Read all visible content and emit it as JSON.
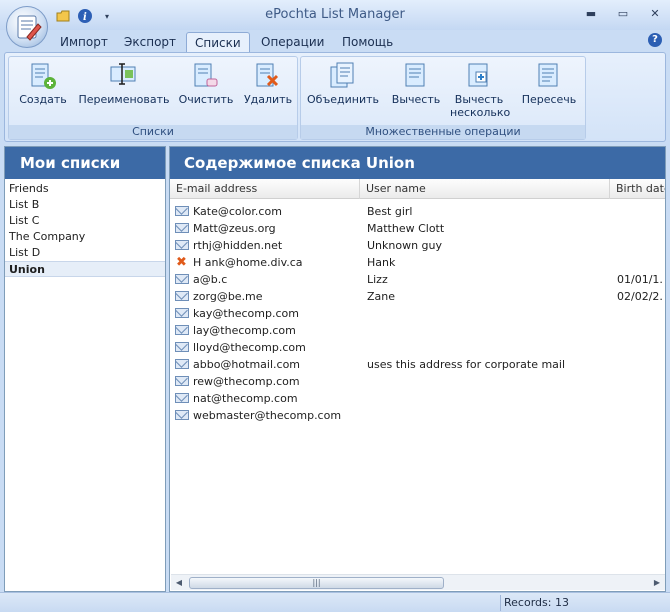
{
  "window": {
    "title": "ePochta List Manager"
  },
  "tabs": [
    {
      "label": "Импорт"
    },
    {
      "label": "Экспорт"
    },
    {
      "label": "Списки",
      "active": true
    },
    {
      "label": "Операции"
    },
    {
      "label": "Помощь"
    }
  ],
  "ribbon": {
    "lists_group": {
      "label": "Списки",
      "buttons": [
        {
          "label": "Создать",
          "icon": "create-list-icon"
        },
        {
          "label": "Переименовать",
          "icon": "rename-list-icon"
        },
        {
          "label": "Очистить",
          "icon": "clear-list-icon"
        },
        {
          "label": "Удалить",
          "icon": "delete-list-icon"
        }
      ]
    },
    "set_ops_group": {
      "label": "Множественные операции",
      "buttons": [
        {
          "label": "Объединить",
          "icon": "merge-lists-icon"
        },
        {
          "label": "Вычесть",
          "icon": "subtract-list-icon"
        },
        {
          "label": "Вычесть несколько",
          "icon": "subtract-multiple-icon"
        },
        {
          "label": "Пересечь",
          "icon": "intersect-lists-icon"
        }
      ]
    }
  },
  "left_pane": {
    "title": "Мои списки",
    "lists": [
      "Friends",
      "List B",
      "List C",
      "The Company",
      "List D",
      "Union"
    ],
    "selected": "Union"
  },
  "right_pane": {
    "title": "Содержимое списка Union",
    "columns": [
      "E-mail address",
      "User name",
      "Birth date"
    ],
    "rows": [
      {
        "email": "Kate@color.com",
        "name": "Best girl",
        "birth": "",
        "status": "ok"
      },
      {
        "email": "Matt@zeus.org",
        "name": "Matthew Clott",
        "birth": "",
        "status": "ok"
      },
      {
        "email": "rthj@hidden.net",
        "name": "Unknown guy",
        "birth": "",
        "status": "ok"
      },
      {
        "email": "H ank@home.div.ca",
        "name": "Hank",
        "birth": "",
        "status": "invalid"
      },
      {
        "email": "a@b.c",
        "name": "Lizz",
        "birth": "01/01/1.",
        "status": "ok"
      },
      {
        "email": "zorg@be.me",
        "name": "Zane",
        "birth": "02/02/2.",
        "status": "ok"
      },
      {
        "email": "kay@thecomp.com",
        "name": "",
        "birth": "",
        "status": "ok"
      },
      {
        "email": "lay@thecomp.com",
        "name": "",
        "birth": "",
        "status": "ok"
      },
      {
        "email": "lloyd@thecomp.com",
        "name": "",
        "birth": "",
        "status": "ok"
      },
      {
        "email": "abbo@hotmail.com",
        "name": "uses this address for corporate mail",
        "birth": "",
        "status": "ok"
      },
      {
        "email": "rew@thecomp.com",
        "name": "",
        "birth": "",
        "status": "ok"
      },
      {
        "email": "nat@thecomp.com",
        "name": "",
        "birth": "",
        "status": "ok"
      },
      {
        "email": "webmaster@thecomp.com",
        "name": "",
        "birth": "",
        "status": "ok"
      }
    ]
  },
  "status": {
    "records": "Records: 13"
  },
  "colors": {
    "header_blue": "#3c6aa6",
    "invalid_mark": "#e05a1a"
  }
}
